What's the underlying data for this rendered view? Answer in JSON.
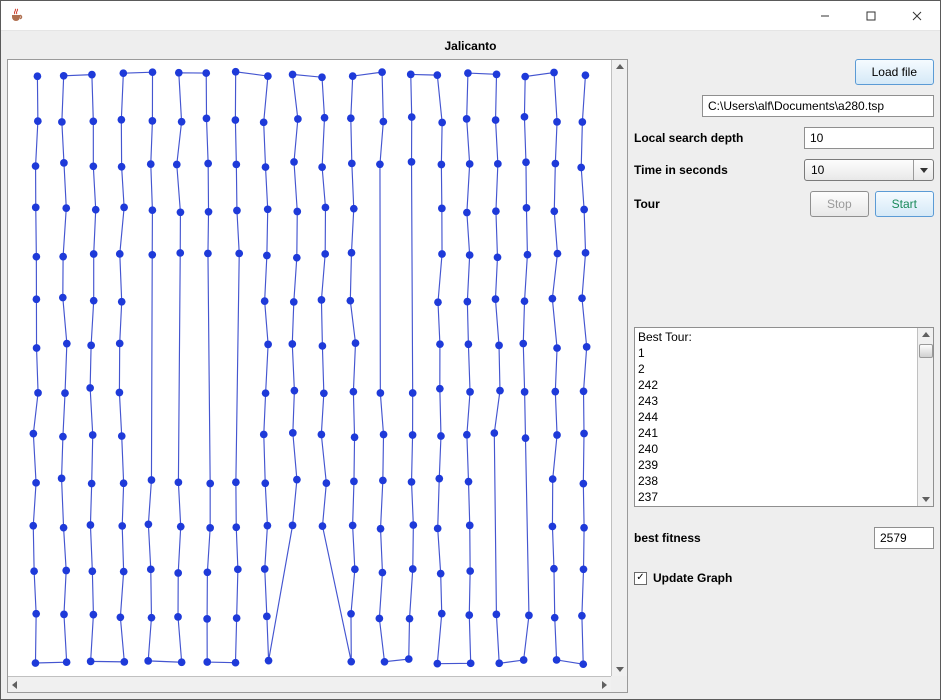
{
  "window": {
    "title": ""
  },
  "app": {
    "title": "Jalicanto"
  },
  "controls": {
    "load_file_label": "Load file",
    "file_path": "C:\\Users\\alf\\Documents\\a280.tsp",
    "local_search_depth_label": "Local search depth",
    "local_search_depth_value": "10",
    "time_in_seconds_label": "Time in seconds",
    "time_in_seconds_value": "10",
    "tour_label": "Tour",
    "stop_label": "Stop",
    "start_label": "Start",
    "best_fitness_label": "best fitness",
    "best_fitness_value": "2579",
    "update_graph_label": "Update Graph",
    "update_graph_checked": true
  },
  "tour_output": {
    "header": "Best Tour:",
    "visible_lines": [
      "1",
      "2",
      "242",
      "243",
      "244",
      "241",
      "240",
      "239",
      "238",
      "237"
    ]
  },
  "graph": {
    "node_color": "#1e3ad9",
    "edge_color": "#4455d0",
    "node_radius": 4
  }
}
